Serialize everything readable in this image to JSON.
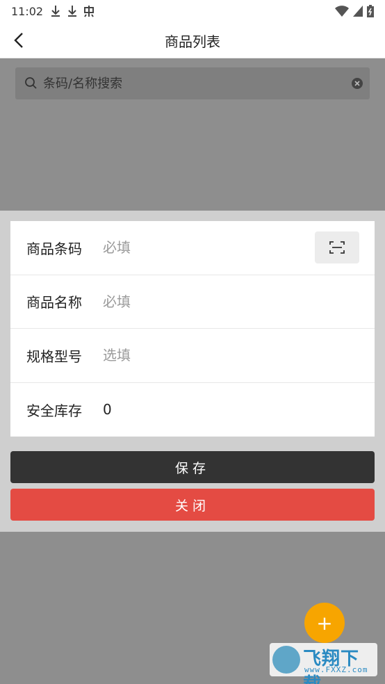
{
  "status_bar": {
    "time": "11:02"
  },
  "navbar": {
    "title": "商品列表"
  },
  "search": {
    "placeholder": "条码/名称搜索"
  },
  "form": {
    "fields": [
      {
        "label": "商品条码",
        "value": "",
        "placeholder": "必填"
      },
      {
        "label": "商品名称",
        "value": "",
        "placeholder": "必填"
      },
      {
        "label": "规格型号",
        "value": "",
        "placeholder": "选填"
      },
      {
        "label": "安全库存",
        "value": "0",
        "placeholder": ""
      }
    ]
  },
  "buttons": {
    "save": "保存",
    "close": "关闭"
  },
  "fab": {
    "label": "+"
  },
  "watermark": {
    "brand": "飞翔下载",
    "domain": "www.FXXZ.com"
  },
  "colors": {
    "save_bg": "#333333",
    "close_bg": "#e44b43",
    "fab_bg": "#f7a500"
  }
}
